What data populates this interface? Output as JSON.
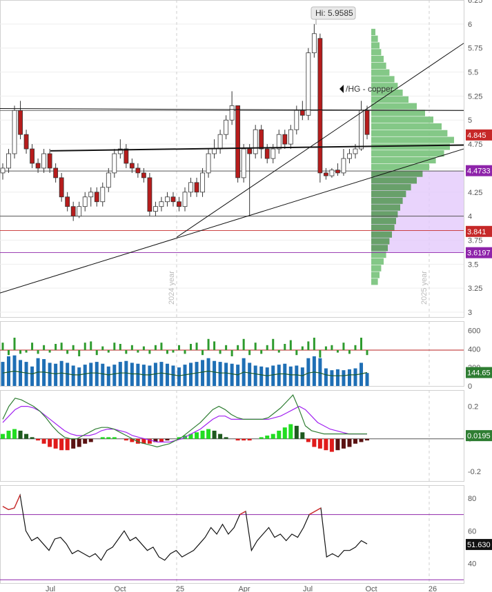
{
  "chart_data": [
    {
      "type": "candlestick",
      "name": "price",
      "y_ticks": [
        "6.25",
        "6",
        "5.75",
        "5.5",
        "5.25",
        "5",
        "4.75",
        "4.5",
        "4.25",
        "4",
        "3.75",
        "3.5",
        "3.25",
        "3"
      ],
      "ylim": [
        2.95,
        6.25
      ],
      "annotations": {
        "high_label": "Hi: 5.9585",
        "symbol_label": "/HG - copper",
        "year_label_2024": "2024 year",
        "year_label_2025": "2025 year"
      },
      "price_tags": [
        {
          "text": "4.845",
          "value": 4.845,
          "color": "#c62828"
        },
        {
          "text": "4.4733",
          "value": 4.4733,
          "color": "#8e24aa"
        },
        {
          "text": "3.841",
          "value": 3.841,
          "color": "#c62828"
        },
        {
          "text": "3.6197",
          "value": 3.6197,
          "color": "#8e24aa"
        }
      ],
      "horizontal_levels": [
        5.1,
        4.47,
        4.0,
        3.85,
        3.62
      ],
      "trendlines": [
        {
          "x": [
            0,
            96
          ],
          "y": [
            3.78,
            5.8
          ]
        },
        {
          "x": [
            0,
            96
          ],
          "y": [
            3.2,
            4.7
          ]
        },
        {
          "x": [
            8,
            96
          ],
          "y": [
            4.68,
            4.74
          ]
        },
        {
          "x": [
            3,
            96
          ],
          "y": [
            5.12,
            5.1
          ]
        }
      ],
      "candles": [
        [
          4.45,
          4.55,
          4.38,
          4.5
        ],
        [
          4.5,
          4.7,
          4.45,
          4.65
        ],
        [
          4.65,
          5.15,
          4.6,
          5.1
        ],
        [
          5.1,
          5.2,
          4.8,
          4.85
        ],
        [
          4.85,
          4.9,
          4.65,
          4.7
        ],
        [
          4.7,
          4.75,
          4.5,
          4.55
        ],
        [
          4.55,
          4.6,
          4.45,
          4.5
        ],
        [
          4.5,
          4.7,
          4.45,
          4.65
        ],
        [
          4.65,
          4.7,
          4.45,
          4.5
        ],
        [
          4.5,
          4.55,
          4.35,
          4.4
        ],
        [
          4.4,
          4.45,
          4.15,
          4.2
        ],
        [
          4.2,
          4.25,
          4.05,
          4.1
        ],
        [
          4.1,
          4.15,
          3.95,
          4.0
        ],
        [
          4.0,
          4.15,
          3.98,
          4.1
        ],
        [
          4.1,
          4.25,
          4.05,
          4.2
        ],
        [
          4.2,
          4.3,
          4.1,
          4.25
        ],
        [
          4.25,
          4.3,
          4.1,
          4.15
        ],
        [
          4.15,
          4.35,
          4.1,
          4.3
        ],
        [
          4.3,
          4.5,
          4.25,
          4.45
        ],
        [
          4.45,
          4.7,
          4.4,
          4.65
        ],
        [
          4.65,
          4.8,
          4.6,
          4.7
        ],
        [
          4.7,
          4.75,
          4.5,
          4.55
        ],
        [
          4.55,
          4.6,
          4.45,
          4.5
        ],
        [
          4.5,
          4.55,
          4.4,
          4.45
        ],
        [
          4.45,
          4.5,
          4.35,
          4.4
        ],
        [
          4.4,
          4.45,
          4.0,
          4.05
        ],
        [
          4.05,
          4.15,
          4.0,
          4.1
        ],
        [
          4.1,
          4.2,
          4.05,
          4.15
        ],
        [
          4.15,
          4.25,
          4.1,
          4.2
        ],
        [
          4.2,
          4.25,
          4.1,
          4.15
        ],
        [
          4.15,
          4.2,
          4.05,
          4.1
        ],
        [
          4.1,
          4.3,
          4.05,
          4.25
        ],
        [
          4.25,
          4.4,
          4.2,
          4.35
        ],
        [
          4.35,
          4.4,
          4.2,
          4.25
        ],
        [
          4.25,
          4.5,
          4.2,
          4.45
        ],
        [
          4.45,
          4.7,
          4.4,
          4.65
        ],
        [
          4.65,
          4.8,
          4.6,
          4.7
        ],
        [
          4.7,
          4.9,
          4.65,
          4.85
        ],
        [
          4.85,
          5.05,
          4.8,
          5.0
        ],
        [
          5.0,
          5.3,
          4.95,
          5.15
        ],
        [
          5.15,
          5.12,
          4.35,
          4.4
        ],
        [
          4.4,
          4.75,
          4.35,
          4.7
        ],
        [
          4.7,
          4.75,
          4.0,
          4.65
        ],
        [
          4.65,
          4.95,
          4.6,
          4.9
        ],
        [
          4.9,
          4.95,
          4.6,
          4.7
        ],
        [
          4.7,
          4.75,
          4.55,
          4.6
        ],
        [
          4.6,
          4.75,
          4.55,
          4.7
        ],
        [
          4.7,
          4.9,
          4.65,
          4.85
        ],
        [
          4.85,
          4.9,
          4.7,
          4.75
        ],
        [
          4.75,
          4.95,
          4.7,
          4.9
        ],
        [
          4.9,
          5.15,
          4.85,
          5.1
        ],
        [
          5.1,
          5.2,
          5.0,
          5.05
        ],
        [
          5.05,
          5.75,
          5.0,
          5.7
        ],
        [
          5.7,
          6.0,
          5.65,
          5.9
        ],
        [
          5.85,
          5.9,
          4.35,
          4.45
        ],
        [
          4.45,
          4.5,
          4.38,
          4.42
        ],
        [
          4.42,
          4.5,
          4.4,
          4.48
        ],
        [
          4.48,
          4.55,
          4.42,
          4.45
        ],
        [
          4.45,
          4.7,
          4.42,
          4.6
        ],
        [
          4.6,
          4.7,
          4.55,
          4.65
        ],
        [
          4.65,
          4.75,
          4.6,
          4.7
        ],
        [
          4.7,
          5.2,
          4.68,
          5.1
        ],
        [
          5.1,
          5.15,
          4.8,
          4.85
        ]
      ],
      "volume_profile": [
        0.05,
        0.08,
        0.1,
        0.12,
        0.15,
        0.18,
        0.22,
        0.28,
        0.32,
        0.38,
        0.45,
        0.55,
        0.65,
        0.75,
        0.85,
        0.92,
        1.0,
        0.95,
        0.88,
        0.78,
        0.7,
        0.62,
        0.55,
        0.48,
        0.42,
        0.38,
        0.35,
        0.32,
        0.3,
        0.28,
        0.25,
        0.22,
        0.2,
        0.18,
        0.15,
        0.12,
        0.1,
        0.08
      ]
    },
    {
      "type": "bar",
      "name": "volume",
      "y_ticks": [
        "600",
        "400",
        "200",
        "0"
      ],
      "ylim": [
        0,
        700
      ],
      "last_value_tag": "144.65",
      "volume": [
        260,
        320,
        330,
        280,
        260,
        210,
        300,
        290,
        250,
        240,
        270,
        250,
        220,
        200,
        230,
        250,
        260,
        240,
        210,
        230,
        260,
        270,
        250,
        240,
        230,
        220,
        250,
        260,
        240,
        220,
        200,
        230,
        250,
        260,
        280,
        300,
        270,
        260,
        250,
        240,
        230,
        300,
        250,
        220,
        210,
        200,
        220,
        230,
        240,
        210,
        220,
        200,
        300,
        320,
        300,
        190,
        170,
        180,
        170,
        180,
        190,
        250,
        140
      ],
      "vol_change": [
        60,
        -40,
        100,
        -30,
        -20,
        60,
        -30,
        40,
        -20,
        50,
        60,
        -30,
        40,
        -50,
        60,
        70,
        -40,
        30,
        -20,
        60,
        50,
        -30,
        40,
        -20,
        30,
        -30,
        40,
        60,
        -30,
        -20,
        40,
        -30,
        50,
        60,
        -40,
        90,
        70,
        -30,
        40,
        -50,
        40,
        90,
        -40,
        60,
        -30,
        40,
        90,
        -20,
        50,
        80,
        -40,
        30,
        70,
        100,
        -60,
        30,
        40,
        -20,
        60,
        -30,
        40,
        100,
        -40
      ],
      "avg_line": [
        140,
        150,
        160,
        150,
        140,
        130,
        150,
        150,
        140,
        130,
        140,
        130,
        120,
        120,
        130,
        140,
        140,
        130,
        120,
        130,
        140,
        140,
        130,
        130,
        120,
        120,
        130,
        140,
        130,
        120,
        110,
        120,
        130,
        140,
        150,
        160,
        150,
        140,
        140,
        130,
        120,
        150,
        140,
        130,
        120,
        110,
        120,
        130,
        130,
        120,
        120,
        110,
        140,
        150,
        140,
        120,
        110,
        110,
        110,
        120,
        120,
        130,
        145
      ]
    },
    {
      "type": "histogram",
      "name": "macd",
      "y_ticks": [
        "0.2",
        "0",
        "-0.2"
      ],
      "ylim": [
        -0.26,
        0.3
      ],
      "last_value_tag": "0.0195",
      "hist": [
        0.03,
        0.05,
        0.06,
        0.05,
        0.03,
        0.01,
        -0.01,
        -0.03,
        -0.05,
        -0.06,
        -0.07,
        -0.07,
        -0.06,
        -0.05,
        -0.03,
        -0.02,
        0,
        0.01,
        0.01,
        0.01,
        0,
        -0.01,
        -0.02,
        -0.03,
        -0.03,
        -0.03,
        -0.02,
        -0.02,
        -0.01,
        0,
        0.01,
        0.02,
        0.03,
        0.04,
        0.05,
        0.06,
        0.05,
        0.03,
        0.01,
        0,
        -0.01,
        -0.01,
        -0.01,
        0,
        0.01,
        0.02,
        0.03,
        0.05,
        0.07,
        0.09,
        0.08,
        0.04,
        -0.02,
        -0.05,
        -0.06,
        -0.07,
        -0.08,
        -0.07,
        -0.06,
        -0.05,
        -0.03,
        -0.02,
        -0.01
      ],
      "signal_line": [
        0.1,
        0.14,
        0.18,
        0.2,
        0.2,
        0.19,
        0.17,
        0.14,
        0.11,
        0.08,
        0.05,
        0.03,
        0.02,
        0.02,
        0.02,
        0.03,
        0.05,
        0.06,
        0.06,
        0.05,
        0.04,
        0.02,
        0.01,
        0,
        -0.01,
        -0.02,
        -0.02,
        -0.02,
        -0.01,
        0,
        0.02,
        0.04,
        0.06,
        0.09,
        0.12,
        0.14,
        0.14,
        0.12,
        0.12,
        0.12,
        0.12,
        0.12,
        0.12,
        0.12,
        0.13,
        0.14,
        0.16,
        0.18,
        0.2,
        0.18,
        0.14,
        0.1,
        0.08,
        0.06,
        0.05,
        0.04,
        0.03,
        0.03,
        0.03,
        0.03
      ],
      "macd_line": [
        0.12,
        0.2,
        0.25,
        0.24,
        0.22,
        0.2,
        0.17,
        0.13,
        0.08,
        0.04,
        0.01,
        0,
        0,
        0.02,
        0.04,
        0.06,
        0.07,
        0.07,
        0.06,
        0.04,
        0.02,
        0,
        -0.02,
        -0.03,
        -0.04,
        -0.05,
        -0.04,
        -0.03,
        -0.01,
        0.01,
        0.04,
        0.07,
        0.1,
        0.14,
        0.18,
        0.2,
        0.18,
        0.15,
        0.13,
        0.12,
        0.12,
        0.12,
        0.12,
        0.13,
        0.16,
        0.19,
        0.23,
        0.27,
        0.18,
        0.08,
        0.05,
        0.04,
        0.03,
        0.03,
        0.03,
        0.03,
        0.03,
        0.03,
        0.03,
        0.03
      ]
    },
    {
      "type": "line",
      "name": "rsi",
      "y_ticks": [
        "80",
        "60",
        "40"
      ],
      "ylim": [
        28,
        88
      ],
      "last_value_tag": "51.630",
      "overbought": 70,
      "oversold": 30,
      "values": [
        75,
        73,
        74,
        82,
        60,
        54,
        56,
        52,
        48,
        55,
        56,
        52,
        46,
        48,
        46,
        44,
        46,
        42,
        48,
        50,
        55,
        60,
        54,
        56,
        52,
        48,
        50,
        44,
        42,
        46,
        48,
        44,
        46,
        48,
        52,
        56,
        62,
        58,
        64,
        58,
        62,
        70,
        72,
        48,
        54,
        58,
        62,
        56,
        58,
        54,
        58,
        56,
        62,
        70,
        72,
        74,
        44,
        46,
        44,
        48,
        48,
        50,
        54,
        52
      ]
    }
  ],
  "x_axis": {
    "ticks": [
      "Jul",
      "Oct",
      "25",
      "Apr",
      "Jul",
      "Oct",
      "26"
    ]
  }
}
